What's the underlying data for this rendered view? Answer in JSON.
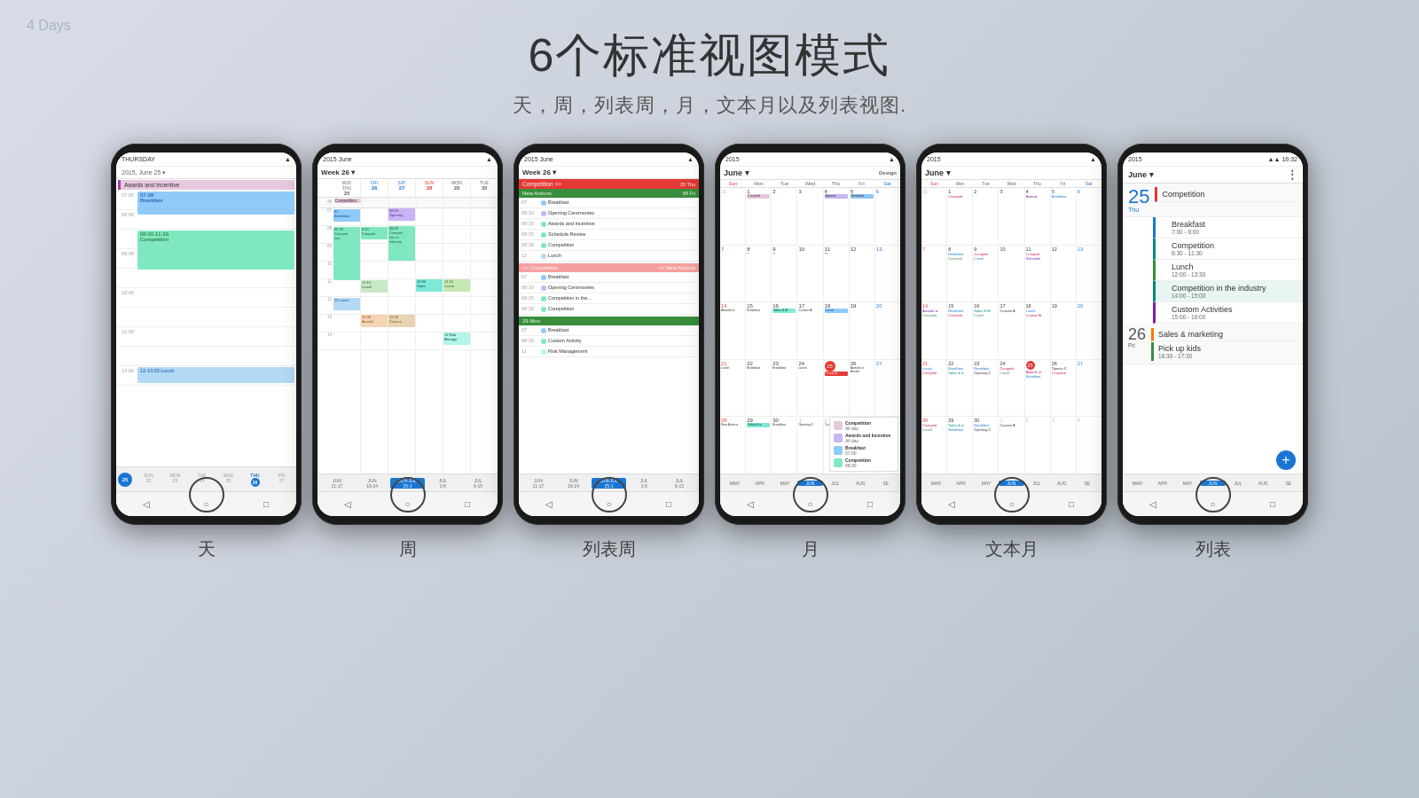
{
  "page": {
    "title": "6个标准视图模式",
    "subtitle": "天，周，列表周，月，文本月以及列表视图.",
    "background_label": "4 Days"
  },
  "phones": [
    {
      "id": "phone-day",
      "label": "天",
      "view": "day",
      "status": "THURSDAY",
      "date": "2015, June 25"
    },
    {
      "id": "phone-week",
      "label": "周",
      "view": "week",
      "status": "2015 June",
      "date": "Week 26"
    },
    {
      "id": "phone-listweek",
      "label": "列表周",
      "view": "listweek",
      "status": "2015 June",
      "date": "Week 26"
    },
    {
      "id": "phone-month",
      "label": "月",
      "view": "month",
      "status": "2015",
      "date": "June"
    },
    {
      "id": "phone-textmonth",
      "label": "文本月",
      "view": "textmonth",
      "status": "2015",
      "date": "June"
    },
    {
      "id": "phone-list",
      "label": "列表",
      "view": "list",
      "status": "2015",
      "date": "June",
      "time": "16:32"
    }
  ],
  "legend": {
    "competition": {
      "label": "Competition",
      "sublabel": "All day",
      "color": "#f5a0a0"
    },
    "awards": {
      "label": "Awards and Incentive",
      "sublabel": "All day",
      "color": "#c8a0e8"
    },
    "breakfast": {
      "label": "Breakfast",
      "sublabel": "07:00",
      "color": "#80c8f0"
    },
    "competition2": {
      "label": "Competition",
      "sublabel": "08:30",
      "color": "#80e8c0"
    }
  },
  "list_events": [
    {
      "title": "Competition",
      "time": "",
      "color": "red",
      "border": "pink-border"
    },
    {
      "title": "Breakfast",
      "time": "7:00 - 8:00",
      "color": "blue",
      "border": "blue-border"
    },
    {
      "title": "Competition",
      "time": "8:30 - 11:30",
      "color": "teal",
      "border": "teal-border"
    },
    {
      "title": "Lunch",
      "time": "12:00 - 13:30",
      "color": "green",
      "border": "green-border"
    },
    {
      "title": "Competition in the industry",
      "time": "14:00 - 15:00",
      "color": "teal",
      "border": "teal-border"
    },
    {
      "title": "Custom Activities",
      "time": "15:00 - 16:00",
      "color": "purple",
      "border": "purple-border"
    },
    {
      "title": "Sales & marketing",
      "time": "",
      "color": "orange",
      "border": "orange-border"
    },
    {
      "title": "Pick up kids",
      "time": "16:30 - 17:30",
      "color": "green",
      "border": "green-border"
    }
  ]
}
